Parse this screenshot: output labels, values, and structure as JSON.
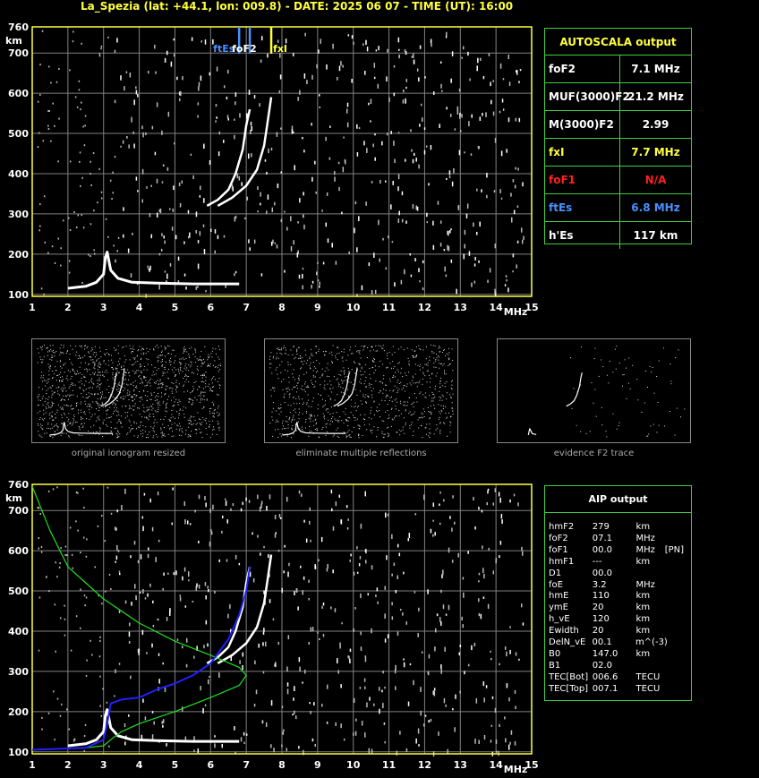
{
  "title": "La_Spezia (lat: +44.1, lon: 009.8) - DATE: 2025 06 07 - TIME (UT): 16:00",
  "colors": {
    "axis": "#ffff40",
    "grid": "#808080",
    "trace": "#ffffff",
    "foF2": "#4a90ff",
    "fxI": "#ffff40",
    "foF1": "#ff2020",
    "ftEs": "#4a90ff",
    "profile": "#2020ff",
    "model": "#20e020"
  },
  "ionogram_top": {
    "chart_data": {
      "type": "scatter",
      "xlabel": "MHz",
      "ylabel": "km",
      "xlim": [
        1,
        15
      ],
      "ylim": [
        95,
        765
      ],
      "x_ticks": [
        "1",
        "2",
        "3",
        "4",
        "5",
        "6",
        "7",
        "8",
        "9",
        "10",
        "11",
        "12",
        "13",
        "14",
        "15"
      ],
      "y_ticks": [
        "100",
        "200",
        "300",
        "400",
        "500",
        "600",
        "700",
        "760"
      ],
      "markers": [
        {
          "name": "ftEs",
          "x": 6.8,
          "color": "#4a90ff"
        },
        {
          "name": "foF2",
          "x": 7.1,
          "color": "#4a90ff"
        },
        {
          "name": "fxI",
          "x": 7.7,
          "color": "#ffff40"
        }
      ],
      "traces": {
        "es_layer": [
          [
            2.0,
            115
          ],
          [
            2.5,
            120
          ],
          [
            2.8,
            130
          ],
          [
            3.0,
            150
          ],
          [
            3.05,
            190
          ],
          [
            3.1,
            205
          ],
          [
            3.2,
            160
          ],
          [
            3.4,
            140
          ],
          [
            3.8,
            130
          ],
          [
            4.5,
            128
          ],
          [
            5.5,
            126
          ],
          [
            6.8,
            126
          ]
        ],
        "o_mode": [
          [
            5.9,
            320
          ],
          [
            6.2,
            335
          ],
          [
            6.5,
            360
          ],
          [
            6.7,
            400
          ],
          [
            6.9,
            460
          ],
          [
            7.0,
            520
          ],
          [
            7.1,
            560
          ]
        ],
        "x_mode": [
          [
            6.2,
            320
          ],
          [
            6.6,
            340
          ],
          [
            7.0,
            370
          ],
          [
            7.3,
            410
          ],
          [
            7.5,
            470
          ],
          [
            7.6,
            530
          ],
          [
            7.7,
            590
          ]
        ]
      }
    }
  },
  "autoscala": {
    "header": "AUTOSCALA output",
    "rows": [
      {
        "key": "foF2",
        "value": "7.1 MHz",
        "color": "#ffffff"
      },
      {
        "key": "MUF(3000)F2",
        "value": "21.2 MHz",
        "color": "#ffffff"
      },
      {
        "key": "M(3000)F2",
        "value": "2.99",
        "color": "#ffffff"
      },
      {
        "key": "fxI",
        "value": "7.7 MHz",
        "color": "#ffff40"
      },
      {
        "key": "foF1",
        "value": "N/A",
        "color": "#ff2020"
      },
      {
        "key": "ftEs",
        "value": "6.8 MHz",
        "color": "#4a90ff"
      },
      {
        "key": "h'Es",
        "value": "117     km",
        "color": "#ffffff"
      }
    ]
  },
  "thumbnails": [
    {
      "caption": "original ionogram resized"
    },
    {
      "caption": "eliminate multiple reflections"
    },
    {
      "caption": "evidence F2 trace"
    }
  ],
  "ionogram_bottom": {
    "chart_data": {
      "type": "line",
      "xlabel": "MHz",
      "ylabel": "km",
      "xlim": [
        1,
        15
      ],
      "ylim": [
        95,
        765
      ],
      "profile": [
        [
          1,
          105
        ],
        [
          2.5,
          110
        ],
        [
          3.0,
          130
        ],
        [
          3.1,
          170
        ],
        [
          3.2,
          220
        ],
        [
          3.5,
          230
        ],
        [
          4.0,
          235
        ],
        [
          4.5,
          255
        ],
        [
          5.0,
          270
        ],
        [
          5.5,
          290
        ],
        [
          6.0,
          320
        ],
        [
          6.5,
          380
        ],
        [
          6.8,
          440
        ],
        [
          7.0,
          500
        ],
        [
          7.1,
          560
        ]
      ],
      "model": [
        [
          1,
          760
        ],
        [
          1.5,
          650
        ],
        [
          2,
          560
        ],
        [
          3,
          480
        ],
        [
          4,
          420
        ],
        [
          5,
          375
        ],
        [
          6,
          340
        ],
        [
          6.8,
          310
        ],
        [
          7.0,
          290
        ],
        [
          6.8,
          265
        ],
        [
          6,
          235
        ],
        [
          5,
          200
        ],
        [
          4,
          170
        ],
        [
          3.5,
          150
        ],
        [
          3.2,
          130
        ],
        [
          3.0,
          115
        ],
        [
          2.5,
          110
        ],
        [
          1,
          105
        ]
      ]
    }
  },
  "aip": {
    "header": "AIP output",
    "rows": [
      [
        "hmF2",
        "279",
        "km",
        ""
      ],
      [
        "foF2",
        "07.1",
        "MHz",
        ""
      ],
      [
        "foF1",
        "00.0",
        "MHz",
        "[PN]"
      ],
      [
        "hmF1",
        "---",
        "km",
        ""
      ],
      [
        "D1",
        "00.0",
        "",
        ""
      ],
      [
        "foE",
        "3.2",
        "MHz",
        ""
      ],
      [
        "hmE",
        "110",
        "km",
        ""
      ],
      [
        "ymE",
        "20",
        "km",
        ""
      ],
      [
        "h_vE",
        "120",
        "km",
        ""
      ],
      [
        "Ewidth",
        "20",
        "km",
        ""
      ],
      [
        "DelN_vE",
        "00.1",
        "m^(-3)",
        ""
      ],
      [
        "B0",
        "147.0",
        "km",
        ""
      ],
      [
        "B1",
        "02.0",
        "",
        ""
      ],
      [
        "TEC[Bot]",
        "006.6",
        "TECU",
        ""
      ],
      [
        "TEC[Top]",
        "007.1",
        "TECU",
        ""
      ]
    ]
  }
}
